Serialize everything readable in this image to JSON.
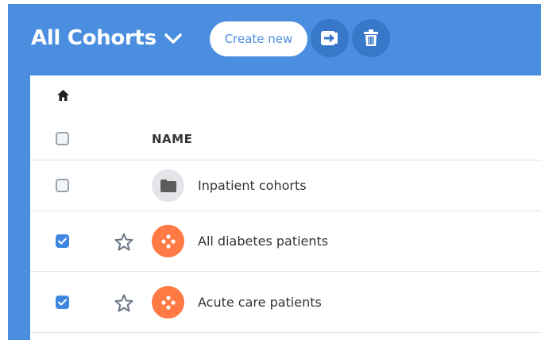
{
  "header": {
    "title": "All Cohorts",
    "create_label": "Create new"
  },
  "table": {
    "column_name": "NAME",
    "rows": [
      {
        "name": "Inpatient cohorts",
        "type": "folder",
        "checked": false,
        "starred": null
      },
      {
        "name": "All diabetes patients",
        "type": "cohort",
        "checked": true,
        "starred": false
      },
      {
        "name": "Acute care patients",
        "type": "cohort",
        "checked": true,
        "starred": false
      }
    ]
  },
  "colors": {
    "header_bg": "#4b8ee0",
    "accent": "#3f86e1",
    "cohort_icon": "#ff7a45"
  },
  "icons": [
    "home-icon",
    "chevron-down-icon",
    "move-to-icon",
    "trash-icon",
    "folder-icon",
    "cohort-icon",
    "star-icon",
    "checkmark-icon"
  ]
}
